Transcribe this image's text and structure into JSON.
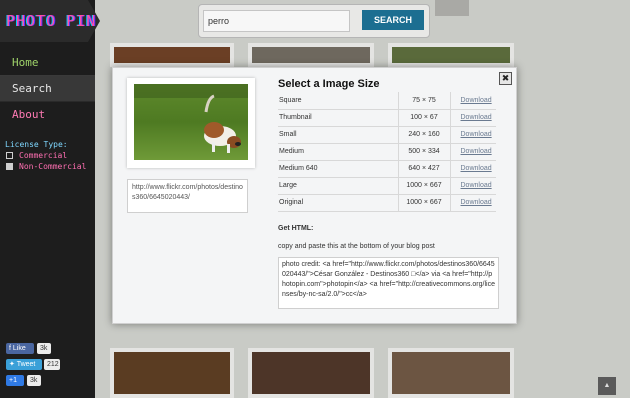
{
  "sidebar": {
    "logo": "PHOTO PIN",
    "nav": [
      {
        "label": "Home"
      },
      {
        "label": "Search"
      },
      {
        "label": "About"
      }
    ],
    "license_title": "License Type:",
    "license_options": [
      {
        "label": "Commercial",
        "checked": false
      },
      {
        "label": "Non-Commercial",
        "checked": true
      }
    ],
    "social": {
      "fb_like": "Like",
      "fb_count": "3k",
      "tweet": "Tweet",
      "tweet_count": "212",
      "gplus": "+1",
      "gplus_count": "3k"
    }
  },
  "search": {
    "value": "perro",
    "button_label": "SEARCH"
  },
  "modal": {
    "title": "Select a Image Size",
    "close_glyph": "✖",
    "photo_url": "http://www.flickr.com/photos/destinos360/6645020443/",
    "sizes": [
      {
        "name": "Square",
        "dims": "75 × 75",
        "action": "Download"
      },
      {
        "name": "Thumbnail",
        "dims": "100 × 67",
        "action": "Download"
      },
      {
        "name": "Small",
        "dims": "240 × 160",
        "action": "Download"
      },
      {
        "name": "Medium",
        "dims": "500 × 334",
        "action": "Download"
      },
      {
        "name": "Medium 640",
        "dims": "640 × 427",
        "action": "Download"
      },
      {
        "name": "Large",
        "dims": "1000 × 667",
        "action": "Download"
      },
      {
        "name": "Original",
        "dims": "1000 × 667",
        "action": "Download"
      }
    ],
    "get_html_label": "Get HTML:",
    "get_html_help": "copy and paste this at the bottom of your blog post",
    "html_code": "photo credit: <a href=\"http://www.flickr.com/photos/destinos360/6645020443/\">César González - Destinos360 □</a> via <a href=\"http://photopin.com\">photopin</a> <a href=\"http://creativecommons.org/licenses/by-nc-sa/2.0/\">cc</a>"
  },
  "colors": {
    "accent": "#1c6e91",
    "sidebar_bg": "#1d1d1d",
    "logo": "#ff4fa8"
  }
}
